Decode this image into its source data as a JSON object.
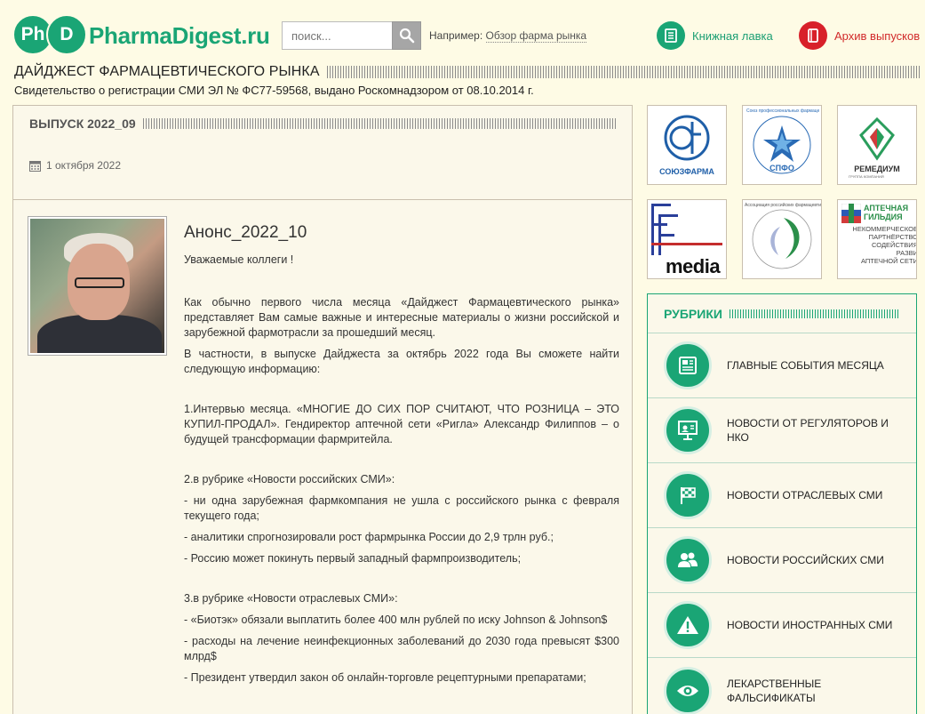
{
  "header": {
    "logo_ph": "Ph",
    "logo_d": "D",
    "logo_text": "PharmaDigest.ru",
    "search_placeholder": "поиск...",
    "example_prefix": "Например:",
    "example_link": "Обзор фарма рынка",
    "bookshop": "Книжная лавка",
    "archive": "Архив выпусков",
    "site_title": "ДАЙДЖЕСТ ФАРМАЦЕВТИЧЕСКОГО РЫНКА",
    "certificate": "Свидетельство о регистрации СМИ ЭЛ № ФС77-59568, выдано Роскомнадзором от 08.10.2014 г."
  },
  "issue": {
    "title": "ВЫПУСК 2022_09",
    "date": "1 октября 2022"
  },
  "article": {
    "title": "Анонс_2022_10",
    "paragraphs": [
      "Уважаемые коллеги !",
      "Как обычно первого числа месяца «Дайджест Фармацевтического рынка» представляет Вам самые важные и интересные материалы о жизни российской и зарубежной фармотрасли за прошедший месяц.",
      "В частности, в выпуске Дайджеста за октябрь 2022 года Вы сможете найти следующую информацию:",
      "1.Интервью месяца. «МНОГИЕ ДО СИХ ПОР СЧИТАЮТ, ЧТО РОЗНИЦА – ЭТО КУПИЛ-ПРОДАЛ». Гендиректор аптечной сети «Ригла» Александр Филиппов – о будущей трансформации фармритейла.",
      "2.в рубрике «Новости российских СМИ»:",
      "- ни одна зарубежная фармкомпания не ушла с российского рынка с февраля текущего года;",
      "- аналитики спрогнозировали рост фармрынка России до 2,9 трлн руб.;",
      "- Россию может покинуть первый западный фармпроизводитель;",
      "3.в рубрике «Новости отраслевых СМИ»:",
      "- «Биотэк» обязали выплатить более 400 млн рублей по иску Johnson & Johnson$",
      "- расходы на лечение неинфекционных заболеваний до 2030 года превысят $300 млрд$",
      "- Президент утвердил закон об онлайн-торговле рецептурными препаратами;"
    ]
  },
  "partners": [
    {
      "label": "СОЮЗФАРМА",
      "color": "#1f5fa8"
    },
    {
      "label": "СПФО",
      "color": "#2a6bb5"
    },
    {
      "label": "РЕМЕДИУМ",
      "color": "#333333"
    },
    {
      "label": "media",
      "color": "#111111"
    },
    {
      "label": "",
      "color": "#2b8f4a"
    },
    {
      "label": "АПТЕЧНАЯ ГИЛЬДИЯ",
      "color": "#2b8f4a"
    }
  ],
  "partner_texts": {
    "spfo_ring": "Союз профессиональных фармацевтических организаций",
    "remedium_sub": "ГРУППА КОМПАНИЙ",
    "guild_lines": [
      "НЕКОММЕРЧЕСКОЕ",
      "ПАРТНЁРСТВО",
      "СОДЕЙСТВИЯ РАЗВИ",
      "АПТЕЧНОЙ СЕТИ"
    ],
    "assoc_ring": "Ассоциация российских фармацевтических производителей"
  },
  "rubrics": {
    "title": "РУБРИКИ",
    "items": [
      {
        "label": "ГЛАВНЫЕ СОБЫТИЯ МЕСЯЦА",
        "icon": "newspaper-icon"
      },
      {
        "label": "НОВОСТИ ОТ РЕГУЛЯТОРОВ И НКО",
        "icon": "presentation-icon"
      },
      {
        "label": "НОВОСТИ ОТРАСЛЕВЫХ СМИ",
        "icon": "checkered-flag-icon"
      },
      {
        "label": "НОВОСТИ РОССИЙСКИХ СМИ",
        "icon": "users-icon"
      },
      {
        "label": "НОВОСТИ ИНОСТРАННЫХ СМИ",
        "icon": "warning-icon"
      },
      {
        "label": "ЛЕКАРСТВЕННЫЕ ФАЛЬСИФИКАТЫ",
        "icon": "eye-icon"
      }
    ]
  },
  "colors": {
    "brand_green": "#1aa575",
    "archive_red": "#d8212a",
    "background": "#fefbe5"
  }
}
